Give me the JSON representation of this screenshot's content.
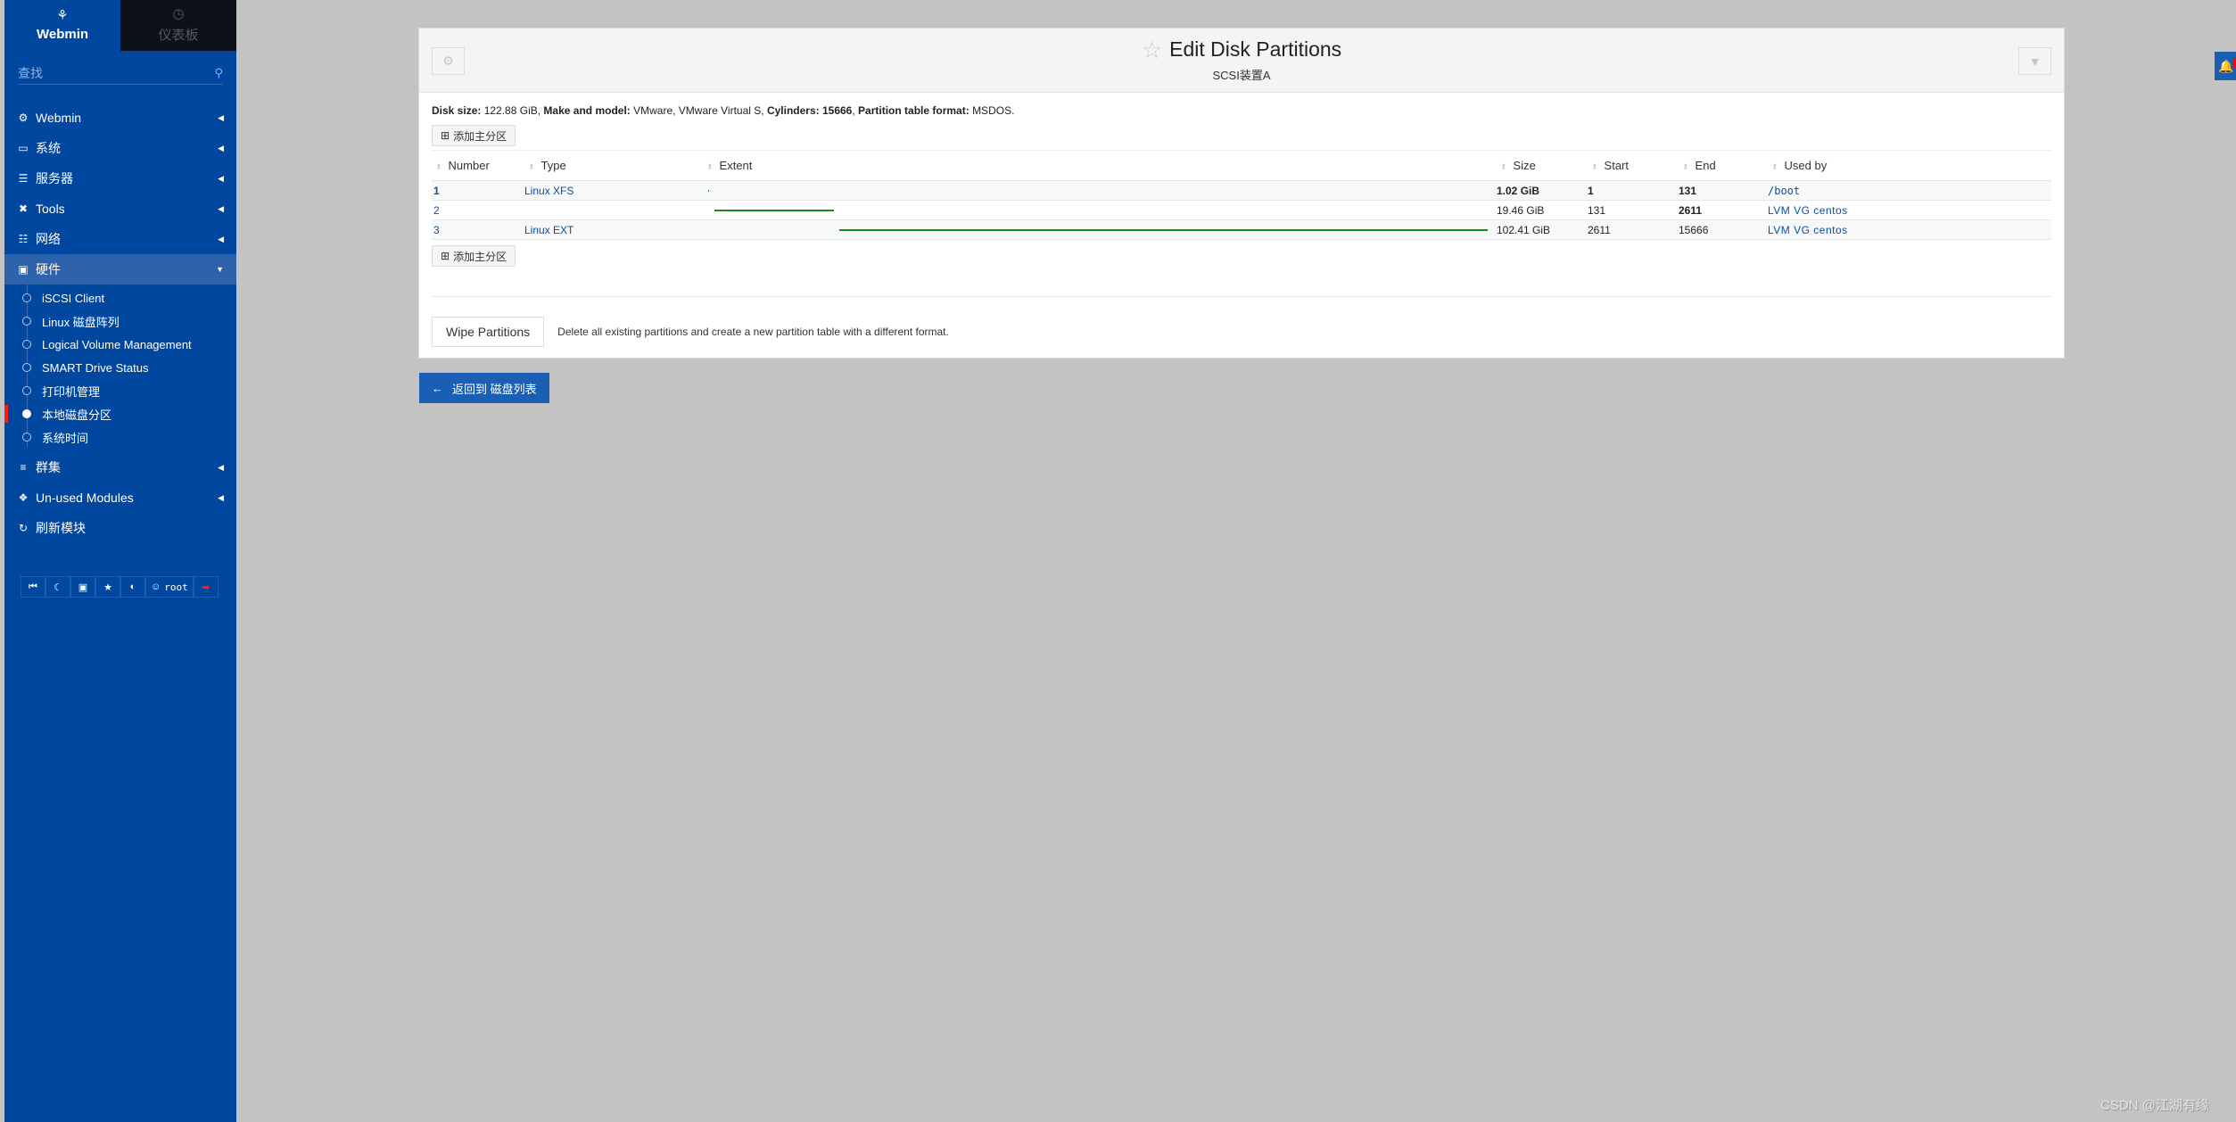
{
  "sidebar": {
    "tabs": [
      {
        "label": "Webmin",
        "icon": "webmin-logo-icon",
        "active": true
      },
      {
        "label": "仪表板",
        "icon": "dashboard-gauge-icon",
        "active": false
      }
    ],
    "search_placeholder": "查找",
    "menu": [
      {
        "label": "Webmin",
        "icon": "gear-icon",
        "state": "collapsed"
      },
      {
        "label": "系统",
        "icon": "laptop-icon",
        "state": "collapsed"
      },
      {
        "label": "服务器",
        "icon": "server-icon",
        "state": "collapsed"
      },
      {
        "label": "Tools",
        "icon": "wrench-screwdriver-icon",
        "state": "collapsed"
      },
      {
        "label": "网络",
        "icon": "network-icon",
        "state": "collapsed"
      },
      {
        "label": "硬件",
        "icon": "hdd-icon",
        "state": "expanded"
      }
    ],
    "hardware_submenu": [
      {
        "label": "iSCSI Client",
        "active": false
      },
      {
        "label": "Linux 磁盘阵列",
        "active": false
      },
      {
        "label": "Logical Volume Management",
        "active": false
      },
      {
        "label": "SMART Drive Status",
        "active": false
      },
      {
        "label": "打印机管理",
        "active": false
      },
      {
        "label": "本地磁盘分区",
        "active": true
      },
      {
        "label": "系统时间",
        "active": false
      }
    ],
    "menu_after": [
      {
        "label": "群集",
        "icon": "layers-icon",
        "state": "collapsed"
      },
      {
        "label": "Un-used Modules",
        "icon": "puzzle-icon",
        "state": "collapsed"
      },
      {
        "label": "刷新模块",
        "icon": "refresh-icon",
        "state": "none"
      }
    ],
    "bottom_bar": {
      "buttons": [
        "collapse-sidebar-icon",
        "night-mode-icon",
        "terminal-icon",
        "favorites-star-icon",
        "palette-icon"
      ],
      "user": "root",
      "logout_icon": "logout-icon",
      "logout_color": "#ff2020"
    }
  },
  "panel": {
    "title": "Edit Disk Partitions",
    "subtitle": "SCSI装置A",
    "disk_info": {
      "size_label": "Disk size:",
      "size_value": "122.88 GiB",
      "model_label": "Make and model:",
      "model_value": "VMware, VMware Virtual S",
      "cylinders_label": "Cylinders:",
      "cylinders_value": "15666",
      "format_label": "Partition table format:",
      "format_value": "MSDOS."
    },
    "add_primary_label": "添加主分区",
    "table": {
      "columns": [
        "Number",
        "Type",
        "Extent",
        "Size",
        "Start",
        "End",
        "Used by"
      ],
      "total_cylinders": 15666,
      "rows": [
        {
          "number": "1",
          "type": "Linux XFS",
          "size": "1.02 GiB",
          "start": "1",
          "end": "131",
          "used_by": "/boot",
          "extent_start": 1,
          "extent_end": 131
        },
        {
          "number": "2",
          "type": "",
          "size": "19.46 GiB",
          "start": "131",
          "end": "2611",
          "used_by": "LVM VG centos",
          "extent_start": 131,
          "extent_end": 2611
        },
        {
          "number": "3",
          "type": "Linux EXT",
          "size": "102.41 GiB",
          "start": "2611",
          "end": "15666",
          "used_by": "LVM VG centos",
          "extent_start": 2611,
          "extent_end": 15666
        }
      ],
      "extent_color": "#1a8a1a"
    },
    "wipe_button": "Wipe Partitions",
    "wipe_description": "Delete all existing partitions and create a new partition table with a different format."
  },
  "back_button": "返回到 磁盘列表",
  "watermark": "CSDN @江湖有缘",
  "colors": {
    "sidebar": "#0047a0",
    "accent": "#1a5fb4",
    "link": "#0b4ea2",
    "background": "#c2c3c2"
  }
}
